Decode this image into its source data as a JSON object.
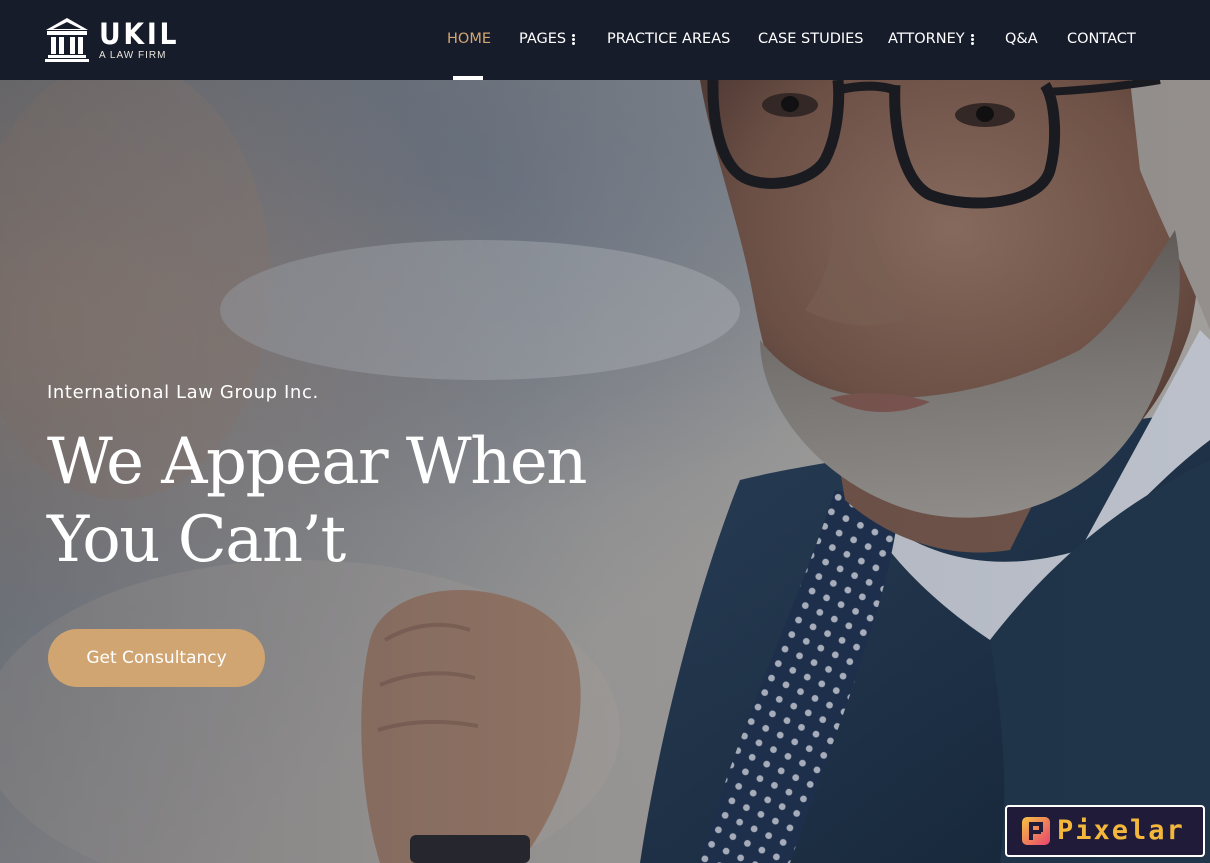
{
  "brand": {
    "name": "UKIL",
    "tagline": "A LAW FIRM"
  },
  "nav": {
    "items": [
      {
        "label": "HOME",
        "active": true,
        "dropdown": false
      },
      {
        "label": "PAGES",
        "active": false,
        "dropdown": true
      },
      {
        "label": "PRACTICE AREAS",
        "active": false,
        "dropdown": false
      },
      {
        "label": "CASE STUDIES",
        "active": false,
        "dropdown": false
      },
      {
        "label": "ATTORNEY",
        "active": false,
        "dropdown": true
      },
      {
        "label": "Q&A",
        "active": false,
        "dropdown": false
      },
      {
        "label": "CONTACT",
        "active": false,
        "dropdown": false
      }
    ]
  },
  "hero": {
    "eyebrow": "International Law Group Inc.",
    "headline_line1": "We Appear When",
    "headline_line2": "You Can’t",
    "cta_label": "Get Consultancy"
  },
  "watermark": {
    "text": "Pixelar"
  },
  "colors": {
    "navbar_bg": "#171c2b",
    "accent": "#d0a571",
    "active_nav": "#d4a672",
    "text": "#ffffff"
  },
  "icons": {
    "logo": "courthouse-icon",
    "dropdown": "vertical-dots-icon",
    "badge": "pixelar-logo-icon"
  }
}
